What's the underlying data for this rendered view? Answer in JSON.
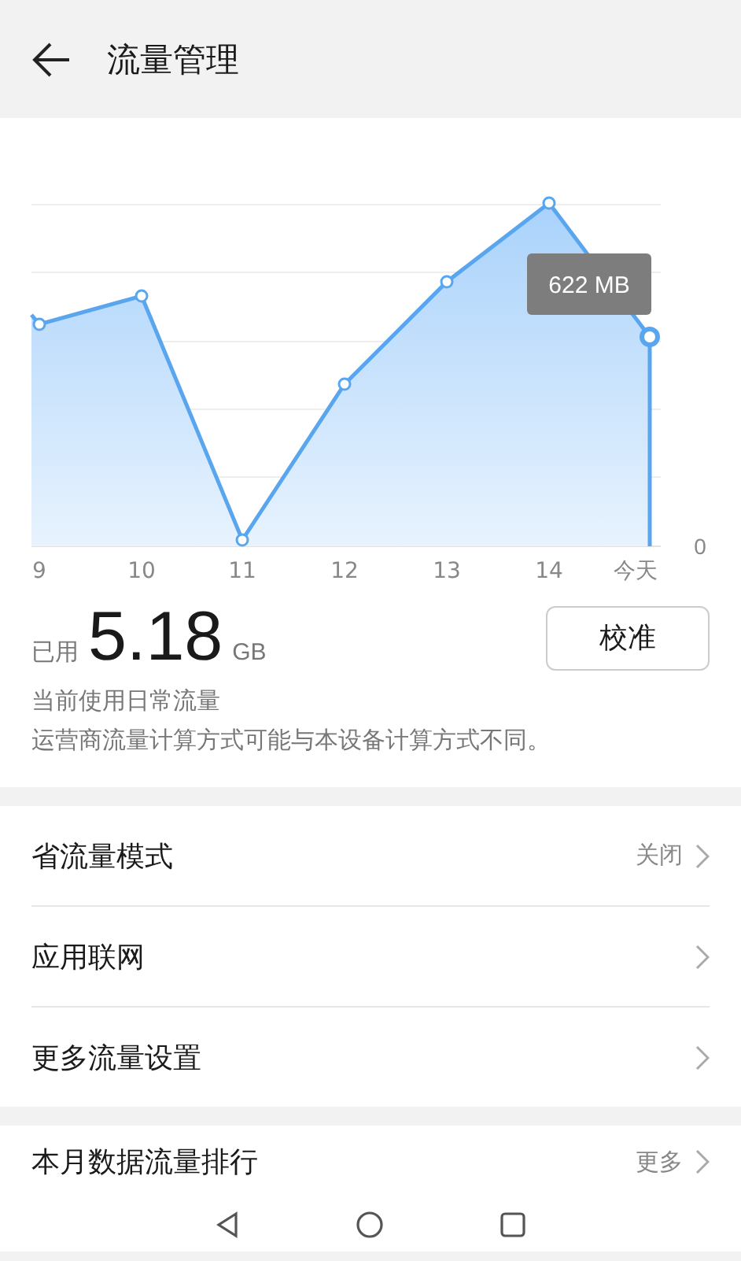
{
  "header": {
    "title": "流量管理"
  },
  "chart": {
    "x_labels": [
      "9",
      "10",
      "11",
      "12",
      "13",
      "14",
      "今天"
    ],
    "y_label": "0",
    "tooltip": "622 MB"
  },
  "usage": {
    "label": "已用",
    "value": "5.18",
    "unit": "GB",
    "button": "校准",
    "lines": [
      "当前使用日常流量",
      "运营商流量计算方式可能与本设备计算方式不同。"
    ]
  },
  "settings": [
    {
      "label": "省流量模式",
      "value": "关闭"
    },
    {
      "label": "应用联网"
    },
    {
      "label": "更多流量设置"
    }
  ],
  "ranking": {
    "label": "本月数据流量排行",
    "value": "更多"
  }
}
